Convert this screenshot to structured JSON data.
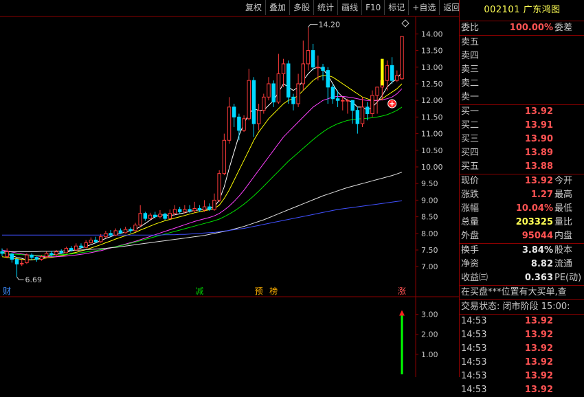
{
  "toolbar": {
    "items": [
      "复权",
      "叠加",
      "多股",
      "统计",
      "画线",
      "F10",
      "标记",
      "+自选",
      "返回"
    ]
  },
  "stock": {
    "code": "002101",
    "name": "广东鸿图"
  },
  "quote_board": {
    "ratio_label": "委比",
    "ratio_value": "100.00%",
    "diff_label": "委差",
    "ask_labels": [
      "卖五",
      "卖四",
      "卖三",
      "卖二",
      "卖一"
    ],
    "bids": [
      {
        "label": "买一",
        "price": "13.92"
      },
      {
        "label": "买二",
        "price": "13.91"
      },
      {
        "label": "买三",
        "price": "13.90"
      },
      {
        "label": "买四",
        "price": "13.89"
      },
      {
        "label": "买五",
        "price": "13.88"
      }
    ],
    "stats1": [
      {
        "label": "现价",
        "value": "13.92",
        "right": "今开",
        "color": "red"
      },
      {
        "label": "涨跌",
        "value": "1.27",
        "right": "最高",
        "color": "red"
      },
      {
        "label": "涨幅",
        "value": "10.04%",
        "right": "最低",
        "color": "red"
      },
      {
        "label": "总量",
        "value": "203325",
        "right": "量比",
        "color": "yel"
      },
      {
        "label": "外盘",
        "value": "95044",
        "right": "内盘",
        "color": "red"
      }
    ],
    "stats2": [
      {
        "label": "换手",
        "value": "3.84%",
        "right": "股本",
        "color": "wht"
      },
      {
        "label": "净资",
        "value": "8.82",
        "right": "流通",
        "color": "wht"
      },
      {
        "label": "收益㈢",
        "value": "0.363",
        "right": "PE(动)",
        "color": "wht"
      }
    ],
    "marquee": "在买盘***位置有大买单,查",
    "trade_status_label": "交易状态:",
    "trade_status_value": "闭市阶段",
    "trade_status_time": "15:00:",
    "ticks": [
      {
        "time": "14:53",
        "price": "13.92"
      },
      {
        "time": "14:53",
        "price": "13.92"
      },
      {
        "time": "14:53",
        "price": "13.92"
      },
      {
        "time": "14:53",
        "price": "13.92"
      },
      {
        "time": "14:53",
        "price": "13.92"
      },
      {
        "time": "14:53",
        "price": "13.92"
      }
    ]
  },
  "chart_data": {
    "type": "candlestick",
    "price_axis": {
      "ticks": [
        "14.00",
        "13.50",
        "13.00",
        "12.50",
        "12.00",
        "11.50",
        "11.00",
        "10.50",
        "10.00",
        "9.50",
        "9.00",
        "8.50",
        "8.00",
        "7.50",
        "7.00"
      ],
      "range": [
        6.55,
        14.4
      ]
    },
    "indicator_axis": {
      "ticks": [
        "3.00",
        "2.00",
        "1.00"
      ],
      "range": [
        0,
        3.6
      ]
    },
    "high_label": "14.20",
    "low_label": "6.69",
    "event_markers": [
      {
        "index": 1,
        "text": "财",
        "color": "#3c8cff"
      },
      {
        "index": 40,
        "text": "减",
        "color": "#00c800"
      },
      {
        "index": 52,
        "text": "预",
        "color": "#ffb000"
      },
      {
        "index": 55,
        "text": "榜",
        "color": "#ffb000"
      },
      {
        "index": 81,
        "text": "涨",
        "color": "#ff5353"
      }
    ],
    "candles": [
      [
        7.45,
        7.4,
        7.55,
        7.32
      ],
      [
        7.3,
        7.45,
        7.55,
        7.25
      ],
      [
        7.38,
        7.22,
        7.42,
        7.12
      ],
      [
        7.22,
        7.08,
        7.26,
        6.69
      ],
      [
        7.08,
        7.1,
        7.2,
        7.02
      ],
      [
        7.12,
        7.35,
        7.4,
        7.08
      ],
      [
        7.35,
        7.28,
        7.4,
        7.2
      ],
      [
        7.28,
        7.22,
        7.3,
        7.15
      ],
      [
        7.22,
        7.3,
        7.35,
        7.18
      ],
      [
        7.3,
        7.4,
        7.45,
        7.25
      ],
      [
        7.4,
        7.36,
        7.48,
        7.3
      ],
      [
        7.36,
        7.45,
        7.5,
        7.32
      ],
      [
        7.45,
        7.42,
        7.52,
        7.38
      ],
      [
        7.42,
        7.55,
        7.6,
        7.4
      ],
      [
        7.55,
        7.5,
        7.62,
        7.45
      ],
      [
        7.5,
        7.62,
        7.7,
        7.48
      ],
      [
        7.62,
        7.58,
        7.7,
        7.55
      ],
      [
        7.58,
        7.72,
        7.8,
        7.55
      ],
      [
        7.72,
        7.8,
        7.88,
        7.68
      ],
      [
        7.8,
        7.75,
        7.9,
        7.7
      ],
      [
        7.75,
        7.9,
        7.98,
        7.72
      ],
      [
        7.9,
        8.0,
        8.08,
        7.85
      ],
      [
        8.0,
        7.95,
        8.1,
        7.9
      ],
      [
        7.95,
        8.08,
        8.15,
        7.92
      ],
      [
        8.08,
        8.02,
        8.15,
        7.98
      ],
      [
        8.02,
        8.12,
        8.2,
        8.0
      ],
      [
        8.12,
        8.08,
        8.18,
        8.02
      ],
      [
        8.08,
        8.25,
        8.32,
        8.05
      ],
      [
        8.25,
        8.6,
        8.85,
        8.2
      ],
      [
        8.6,
        8.45,
        8.65,
        8.38
      ],
      [
        8.45,
        8.55,
        8.62,
        8.4
      ],
      [
        8.55,
        8.5,
        8.65,
        8.45
      ],
      [
        8.5,
        8.58,
        8.7,
        8.45
      ],
      [
        8.58,
        8.45,
        8.62,
        8.4
      ],
      [
        8.45,
        8.6,
        8.72,
        8.42
      ],
      [
        8.6,
        8.72,
        8.85,
        8.55
      ],
      [
        8.72,
        8.65,
        8.8,
        8.6
      ],
      [
        8.65,
        8.72,
        8.85,
        8.6
      ],
      [
        8.72,
        8.68,
        8.85,
        8.62
      ],
      [
        8.68,
        8.75,
        8.95,
        8.62
      ],
      [
        8.75,
        8.7,
        8.85,
        8.65
      ],
      [
        8.7,
        8.8,
        9.0,
        8.65
      ],
      [
        8.8,
        8.72,
        8.9,
        8.68
      ],
      [
        8.72,
        9.0,
        9.2,
        8.68
      ],
      [
        9.0,
        9.8,
        9.9,
        8.95
      ],
      [
        9.8,
        10.8,
        11.0,
        9.75
      ],
      [
        10.8,
        11.8,
        12.1,
        10.7
      ],
      [
        11.8,
        11.5,
        11.9,
        11.2
      ],
      [
        11.5,
        11.1,
        11.6,
        10.8
      ],
      [
        11.1,
        11.45,
        11.55,
        11.05
      ],
      [
        11.45,
        12.6,
        12.95,
        11.4
      ],
      [
        12.6,
        11.3,
        12.7,
        10.9
      ],
      [
        11.3,
        11.7,
        11.9,
        11.1
      ],
      [
        11.7,
        12.1,
        12.2,
        11.6
      ],
      [
        12.1,
        12.5,
        12.7,
        12.0
      ],
      [
        12.5,
        11.95,
        12.6,
        11.8
      ],
      [
        11.95,
        12.8,
        13.4,
        11.9
      ],
      [
        12.8,
        13.1,
        13.25,
        12.4
      ],
      [
        13.1,
        12.1,
        13.2,
        11.9
      ],
      [
        12.1,
        11.9,
        12.2,
        11.7
      ],
      [
        11.9,
        12.5,
        12.8,
        11.8
      ],
      [
        12.5,
        13.1,
        13.8,
        12.3
      ],
      [
        13.1,
        13.5,
        14.2,
        12.9
      ],
      [
        13.5,
        13.0,
        13.7,
        12.9
      ],
      [
        13.0,
        13.0,
        13.35,
        12.6
      ],
      [
        13.0,
        12.9,
        13.1,
        12.6
      ],
      [
        12.9,
        12.4,
        13.0,
        11.9
      ],
      [
        12.4,
        12.05,
        12.5,
        11.9
      ],
      [
        12.05,
        12.0,
        12.3,
        11.8
      ],
      [
        12.0,
        12.0,
        12.1,
        11.7
      ],
      [
        12.0,
        12.0,
        12.05,
        11.6
      ],
      [
        12.0,
        11.7,
        12.0,
        11.3
      ],
      [
        11.7,
        11.3,
        11.8,
        11.0
      ],
      [
        11.3,
        11.8,
        12.1,
        11.2
      ],
      [
        11.8,
        11.6,
        11.95,
        11.4
      ],
      [
        11.6,
        12.15,
        12.3,
        11.5
      ],
      [
        12.15,
        12.4,
        12.4,
        11.6
      ],
      [
        12.4,
        12.6,
        12.8,
        12.0
      ],
      [
        12.6,
        13.05,
        13.2,
        12.3
      ],
      [
        13.05,
        12.6,
        13.3,
        12.5
      ],
      [
        12.6,
        12.75,
        12.9,
        12.55
      ],
      [
        12.65,
        13.92,
        13.92,
        12.62
      ]
    ],
    "ma_lines": [
      {
        "name": "MA5",
        "color": "#ffffff",
        "values": [
          7.45,
          7.38,
          7.33,
          7.28,
          7.25,
          7.2,
          7.2,
          7.23,
          7.25,
          7.3,
          7.34,
          7.38,
          7.4,
          7.43,
          7.48,
          7.51,
          7.56,
          7.61,
          7.66,
          7.72,
          7.78,
          7.85,
          7.9,
          7.96,
          8.0,
          8.04,
          8.08,
          8.12,
          8.2,
          8.3,
          8.4,
          8.5,
          8.55,
          8.56,
          8.54,
          8.56,
          8.59,
          8.62,
          8.66,
          8.69,
          8.7,
          8.72,
          8.75,
          8.8,
          9.0,
          9.4,
          9.95,
          10.45,
          10.95,
          11.3,
          11.6,
          11.75,
          11.7,
          11.7,
          11.85,
          12.0,
          12.25,
          12.5,
          12.4,
          12.3,
          12.4,
          12.6,
          12.8,
          12.95,
          13.0,
          12.95,
          12.75,
          12.5,
          12.25,
          12.1,
          12.0,
          11.95,
          11.8,
          11.8,
          11.7,
          11.8,
          11.95,
          12.15,
          12.4,
          12.55,
          12.65,
          12.85
        ]
      },
      {
        "name": "MA10",
        "color": "#ffff00",
        "values": [
          7.3,
          7.28,
          7.26,
          7.24,
          7.22,
          7.21,
          7.21,
          7.22,
          7.24,
          7.26,
          7.28,
          7.3,
          7.33,
          7.36,
          7.4,
          7.43,
          7.47,
          7.51,
          7.56,
          7.61,
          7.66,
          7.72,
          7.77,
          7.83,
          7.88,
          7.93,
          7.98,
          8.03,
          8.1,
          8.16,
          8.22,
          8.28,
          8.33,
          8.38,
          8.42,
          8.46,
          8.5,
          8.54,
          8.58,
          8.62,
          8.65,
          8.68,
          8.71,
          8.75,
          8.85,
          9.05,
          9.3,
          9.6,
          9.9,
          10.2,
          10.5,
          10.8,
          11.05,
          11.25,
          11.45,
          11.6,
          11.75,
          11.9,
          12.0,
          12.05,
          12.15,
          12.3,
          12.45,
          12.6,
          12.7,
          12.75,
          12.75,
          12.7,
          12.6,
          12.5,
          12.4,
          12.3,
          12.2,
          12.1,
          12.05,
          12.0,
          12.0,
          12.05,
          12.15,
          12.25,
          12.35,
          12.5
        ]
      },
      {
        "name": "MA20",
        "color": "#ff40ff",
        "values": [
          7.5,
          7.47,
          7.44,
          7.41,
          7.38,
          7.36,
          7.34,
          7.32,
          7.31,
          7.3,
          7.3,
          7.3,
          7.31,
          7.32,
          7.33,
          7.35,
          7.37,
          7.39,
          7.42,
          7.45,
          7.48,
          7.52,
          7.56,
          7.6,
          7.64,
          7.68,
          7.72,
          7.76,
          7.81,
          7.86,
          7.91,
          7.96,
          8.01,
          8.06,
          8.11,
          8.16,
          8.21,
          8.26,
          8.31,
          8.36,
          8.4,
          8.44,
          8.48,
          8.53,
          8.6,
          8.7,
          8.82,
          8.96,
          9.12,
          9.3,
          9.5,
          9.7,
          9.9,
          10.1,
          10.3,
          10.5,
          10.7,
          10.9,
          11.05,
          11.2,
          11.35,
          11.5,
          11.65,
          11.8,
          11.9,
          12.0,
          12.05,
          12.1,
          12.12,
          12.12,
          12.1,
          12.08,
          12.05,
          12.02,
          12.0,
          12.0,
          12.0,
          12.02,
          12.05,
          12.1,
          12.2,
          12.35
        ]
      },
      {
        "name": "MA30",
        "color": "#00e000",
        "values": [
          7.4,
          7.39,
          7.38,
          7.37,
          7.36,
          7.35,
          7.34,
          7.34,
          7.34,
          7.34,
          7.34,
          7.35,
          7.36,
          7.37,
          7.38,
          7.4,
          7.42,
          7.44,
          7.46,
          7.48,
          7.51,
          7.54,
          7.57,
          7.6,
          7.63,
          7.66,
          7.7,
          7.74,
          7.78,
          7.82,
          7.86,
          7.9,
          7.94,
          7.98,
          8.02,
          8.06,
          8.1,
          8.14,
          8.18,
          8.22,
          8.26,
          8.3,
          8.34,
          8.38,
          8.43,
          8.5,
          8.58,
          8.67,
          8.77,
          8.88,
          9.0,
          9.13,
          9.27,
          9.42,
          9.57,
          9.72,
          9.87,
          10.02,
          10.17,
          10.3,
          10.43,
          10.56,
          10.69,
          10.82,
          10.94,
          11.05,
          11.15,
          11.23,
          11.3,
          11.35,
          11.4,
          11.42,
          11.44,
          11.45,
          11.46,
          11.48,
          11.5,
          11.53,
          11.57,
          11.63,
          11.7,
          11.8
        ]
      },
      {
        "name": "MA60",
        "color": "#e0e0e0",
        "values": [
          7.45,
          7.45,
          7.45,
          7.45,
          7.45,
          7.45,
          7.45,
          7.45,
          7.46,
          7.46,
          7.46,
          7.47,
          7.47,
          7.48,
          7.48,
          7.49,
          7.5,
          7.51,
          7.52,
          7.53,
          7.54,
          7.55,
          7.57,
          7.58,
          7.6,
          7.62,
          7.64,
          7.66,
          7.68,
          7.7,
          7.72,
          7.74,
          7.76,
          7.78,
          7.8,
          7.82,
          7.84,
          7.86,
          7.88,
          7.9,
          7.92,
          7.94,
          7.97,
          8.0,
          8.03,
          8.06,
          8.09,
          8.13,
          8.17,
          8.21,
          8.26,
          8.31,
          8.36,
          8.41,
          8.47,
          8.53,
          8.59,
          8.65,
          8.71,
          8.77,
          8.83,
          8.89,
          8.95,
          9.01,
          9.07,
          9.13,
          9.18,
          9.23,
          9.28,
          9.33,
          9.38,
          9.42,
          9.46,
          9.5,
          9.54,
          9.58,
          9.62,
          9.66,
          9.7,
          9.74,
          9.79,
          9.84
        ]
      },
      {
        "name": "MA120",
        "color": "#4050ff",
        "values": [
          7.95,
          7.95,
          7.95,
          7.95,
          7.95,
          7.95,
          7.95,
          7.95,
          7.95,
          7.95,
          7.95,
          7.95,
          7.95,
          7.95,
          7.95,
          7.95,
          7.95,
          7.95,
          7.95,
          7.95,
          7.95,
          7.95,
          7.95,
          7.95,
          7.95,
          7.95,
          7.95,
          7.95,
          7.95,
          7.95,
          7.95,
          7.95,
          7.95,
          7.96,
          7.96,
          7.96,
          7.97,
          7.97,
          7.98,
          7.99,
          8.0,
          8.01,
          8.02,
          8.03,
          8.05,
          8.07,
          8.09,
          8.11,
          8.13,
          8.15,
          8.18,
          8.21,
          8.24,
          8.27,
          8.3,
          8.33,
          8.36,
          8.39,
          8.42,
          8.45,
          8.48,
          8.51,
          8.54,
          8.57,
          8.6,
          8.63,
          8.66,
          8.69,
          8.72,
          8.74,
          8.76,
          8.78,
          8.8,
          8.82,
          8.84,
          8.86,
          8.88,
          8.9,
          8.92,
          8.94,
          8.96,
          8.98
        ]
      }
    ],
    "indicator_bar": {
      "index": 81,
      "value": 3.0
    }
  }
}
